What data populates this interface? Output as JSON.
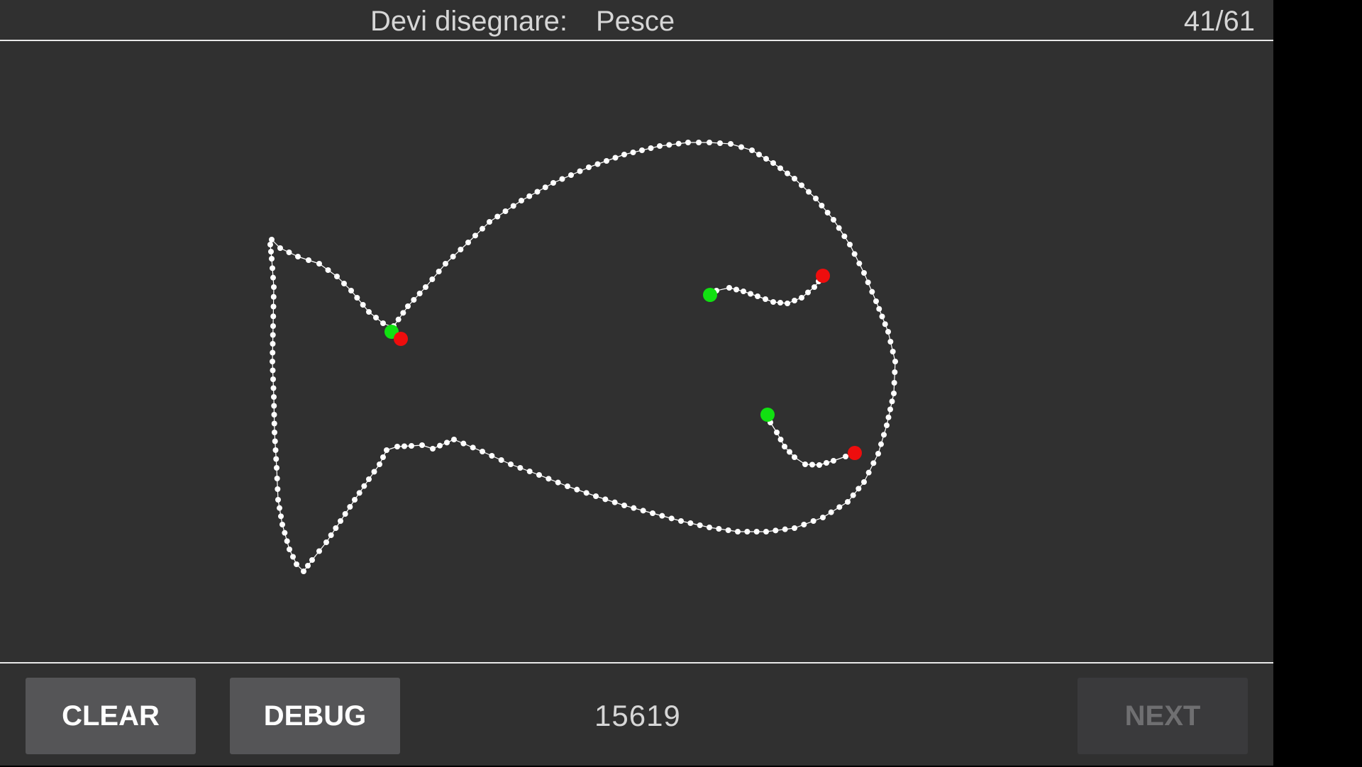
{
  "header": {
    "prompt_label": "Devi disegnare:",
    "prompt_word": "Pesce",
    "counter": "41/61"
  },
  "canvas": {
    "background": "#303030",
    "stroke_color": "#ffffff",
    "start_marker_color": "#11e011",
    "end_marker_color": "#ee0d0d"
  },
  "footer": {
    "clear_label": "CLEAR",
    "debug_label": "DEBUG",
    "score": "15619",
    "next_label": "NEXT",
    "next_enabled": false
  }
}
